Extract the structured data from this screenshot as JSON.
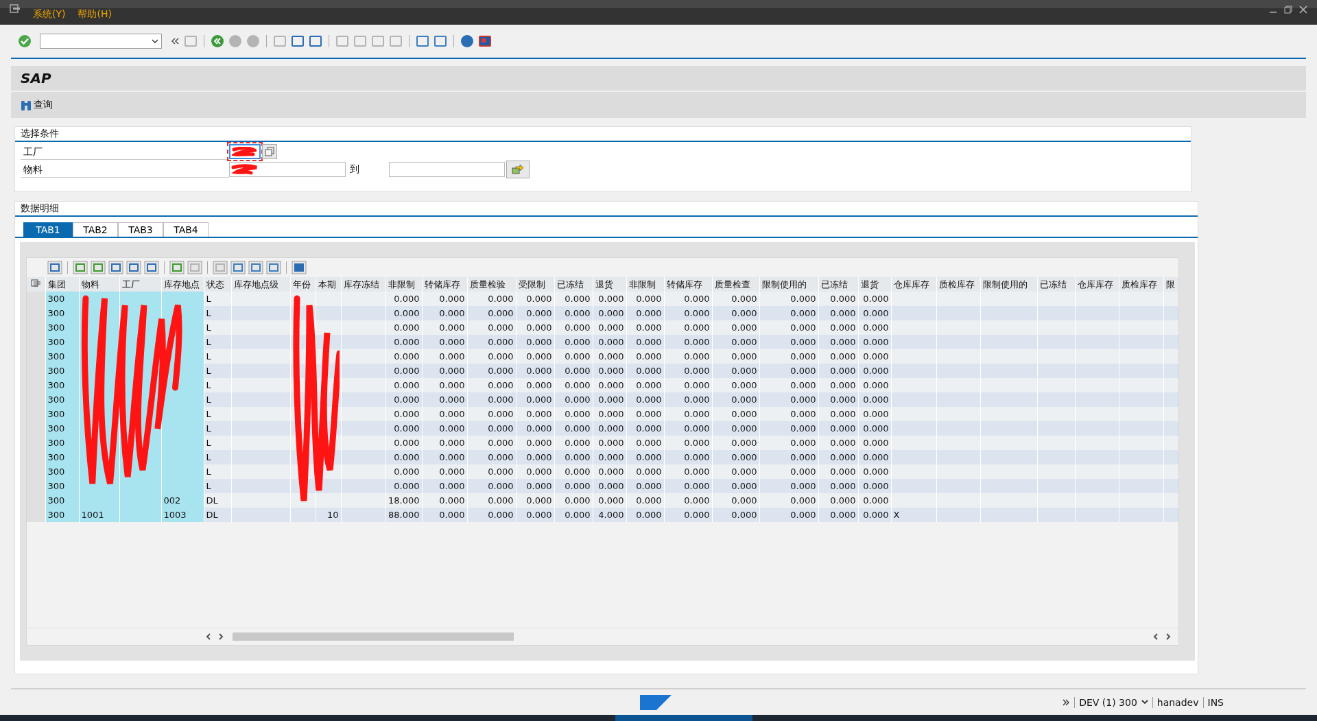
{
  "menu": [
    {
      "label": "系统(Y)"
    },
    {
      "label": "帮助(H)"
    }
  ],
  "title": "SAP",
  "app_toolbar": [
    {
      "label": "查询"
    }
  ],
  "selection": {
    "title": "选择条件",
    "fields": [
      {
        "label": "工厂",
        "kind": "single",
        "focused": true
      },
      {
        "label": "物料",
        "kind": "range",
        "to_label": "到",
        "focused": false
      }
    ]
  },
  "data": {
    "title": "数据明细",
    "tabs": [
      {
        "label": "TAB1",
        "selected": true
      },
      {
        "label": "TAB2",
        "selected": false
      },
      {
        "label": "TAB3",
        "selected": false
      },
      {
        "label": "TAB4",
        "selected": false
      }
    ],
    "columns": [
      {
        "label": "集团",
        "kind": "key"
      },
      {
        "label": "物料",
        "kind": "key"
      },
      {
        "label": "工厂",
        "kind": "key"
      },
      {
        "label": "库存地点",
        "kind": "key"
      },
      {
        "label": "状态",
        "kind": "text"
      },
      {
        "label": "库存地点级",
        "kind": "text"
      },
      {
        "label": "年份",
        "kind": "text"
      },
      {
        "label": "本期",
        "kind": "qty"
      },
      {
        "label": "库存冻结",
        "kind": "text"
      },
      {
        "label": "非限制",
        "kind": "qty"
      },
      {
        "label": "转储库存",
        "kind": "qty"
      },
      {
        "label": "质量检验",
        "kind": "qty"
      },
      {
        "label": "受限制",
        "kind": "qty"
      },
      {
        "label": "已冻结",
        "kind": "qty"
      },
      {
        "label": "退货",
        "kind": "qty"
      },
      {
        "label": "非限制",
        "kind": "qty"
      },
      {
        "label": "转储库存",
        "kind": "qty"
      },
      {
        "label": "质量检查",
        "kind": "qty"
      },
      {
        "label": "限制使用的",
        "kind": "qty"
      },
      {
        "label": "已冻结",
        "kind": "qty"
      },
      {
        "label": "退货",
        "kind": "qty"
      },
      {
        "label": "仓库库存",
        "kind": "text"
      },
      {
        "label": "质检库存",
        "kind": "text"
      },
      {
        "label": "限制使用的",
        "kind": "text"
      },
      {
        "label": "已冻结",
        "kind": "text"
      },
      {
        "label": "仓库库存",
        "kind": "text"
      },
      {
        "label": "质检库存",
        "kind": "text"
      },
      {
        "label": "限",
        "kind": "text"
      }
    ],
    "rows": [
      {
        "cells": [
          "300",
          null,
          null,
          null,
          "L",
          null,
          null,
          null,
          null,
          "0.000",
          "0.000",
          "0.000",
          "0.000",
          "0.000",
          "0.000",
          "0.000",
          "0.000",
          "0.000",
          "0.000",
          "0.000",
          "0.000"
        ]
      },
      {
        "cells": [
          "300",
          null,
          null,
          null,
          "L",
          null,
          null,
          null,
          null,
          "0.000",
          "0.000",
          "0.000",
          "0.000",
          "0.000",
          "0.000",
          "0.000",
          "0.000",
          "0.000",
          "0.000",
          "0.000",
          "0.000"
        ]
      },
      {
        "cells": [
          "300",
          null,
          null,
          null,
          "L",
          null,
          null,
          null,
          null,
          "0.000",
          "0.000",
          "0.000",
          "0.000",
          "0.000",
          "0.000",
          "0.000",
          "0.000",
          "0.000",
          "0.000",
          "0.000",
          "0.000"
        ]
      },
      {
        "cells": [
          "300",
          null,
          null,
          null,
          "L",
          null,
          null,
          null,
          null,
          "0.000",
          "0.000",
          "0.000",
          "0.000",
          "0.000",
          "0.000",
          "0.000",
          "0.000",
          "0.000",
          "0.000",
          "0.000",
          "0.000"
        ]
      },
      {
        "cells": [
          "300",
          null,
          null,
          null,
          "L",
          null,
          null,
          null,
          null,
          "0.000",
          "0.000",
          "0.000",
          "0.000",
          "0.000",
          "0.000",
          "0.000",
          "0.000",
          "0.000",
          "0.000",
          "0.000",
          "0.000"
        ]
      },
      {
        "cells": [
          "300",
          null,
          null,
          null,
          "L",
          null,
          null,
          null,
          null,
          "0.000",
          "0.000",
          "0.000",
          "0.000",
          "0.000",
          "0.000",
          "0.000",
          "0.000",
          "0.000",
          "0.000",
          "0.000",
          "0.000"
        ]
      },
      {
        "cells": [
          "300",
          null,
          null,
          null,
          "L",
          null,
          null,
          null,
          null,
          "0.000",
          "0.000",
          "0.000",
          "0.000",
          "0.000",
          "0.000",
          "0.000",
          "0.000",
          "0.000",
          "0.000",
          "0.000",
          "0.000"
        ]
      },
      {
        "cells": [
          "300",
          null,
          null,
          null,
          "L",
          null,
          null,
          null,
          null,
          "0.000",
          "0.000",
          "0.000",
          "0.000",
          "0.000",
          "0.000",
          "0.000",
          "0.000",
          "0.000",
          "0.000",
          "0.000",
          "0.000"
        ]
      },
      {
        "cells": [
          "300",
          null,
          null,
          null,
          "L",
          null,
          null,
          null,
          null,
          "0.000",
          "0.000",
          "0.000",
          "0.000",
          "0.000",
          "0.000",
          "0.000",
          "0.000",
          "0.000",
          "0.000",
          "0.000",
          "0.000"
        ]
      },
      {
        "cells": [
          "300",
          null,
          null,
          null,
          "L",
          null,
          null,
          null,
          null,
          "0.000",
          "0.000",
          "0.000",
          "0.000",
          "0.000",
          "0.000",
          "0.000",
          "0.000",
          "0.000",
          "0.000",
          "0.000",
          "0.000"
        ]
      },
      {
        "cells": [
          "300",
          null,
          null,
          null,
          "L",
          null,
          null,
          null,
          null,
          "0.000",
          "0.000",
          "0.000",
          "0.000",
          "0.000",
          "0.000",
          "0.000",
          "0.000",
          "0.000",
          "0.000",
          "0.000",
          "0.000"
        ]
      },
      {
        "cells": [
          "300",
          null,
          null,
          null,
          "L",
          null,
          null,
          null,
          null,
          "0.000",
          "0.000",
          "0.000",
          "0.000",
          "0.000",
          "0.000",
          "0.000",
          "0.000",
          "0.000",
          "0.000",
          "0.000",
          "0.000"
        ]
      },
      {
        "cells": [
          "300",
          null,
          null,
          null,
          "L",
          null,
          null,
          null,
          null,
          "0.000",
          "0.000",
          "0.000",
          "0.000",
          "0.000",
          "0.000",
          "0.000",
          "0.000",
          "0.000",
          "0.000",
          "0.000",
          "0.000"
        ]
      },
      {
        "cells": [
          "300",
          null,
          null,
          null,
          "L",
          null,
          null,
          null,
          null,
          "0.000",
          "0.000",
          "0.000",
          "0.000",
          "0.000",
          "0.000",
          "0.000",
          "0.000",
          "0.000",
          "0.000",
          "0.000",
          "0.000"
        ]
      },
      {
        "cells": [
          "300",
          null,
          null,
          "002",
          "DL",
          null,
          null,
          null,
          null,
          "18.000",
          "0.000",
          "0.000",
          "0.000",
          "0.000",
          "0.000",
          "0.000",
          "0.000",
          "0.000",
          "0.000",
          "0.000",
          "0.000"
        ]
      },
      {
        "cells": [
          "300",
          "1001",
          null,
          "1003",
          "DL",
          null,
          null,
          "10",
          null,
          "88.000",
          "0.000",
          "0.000",
          "0.000",
          "0.000",
          "4.000",
          "0.000",
          "0.000",
          "0.000",
          "0.000",
          "0.000",
          "0.000",
          "X"
        ]
      }
    ]
  },
  "status_bar": {
    "system": "DEV (1) 300",
    "user": "hanadev",
    "mode": "INS"
  }
}
